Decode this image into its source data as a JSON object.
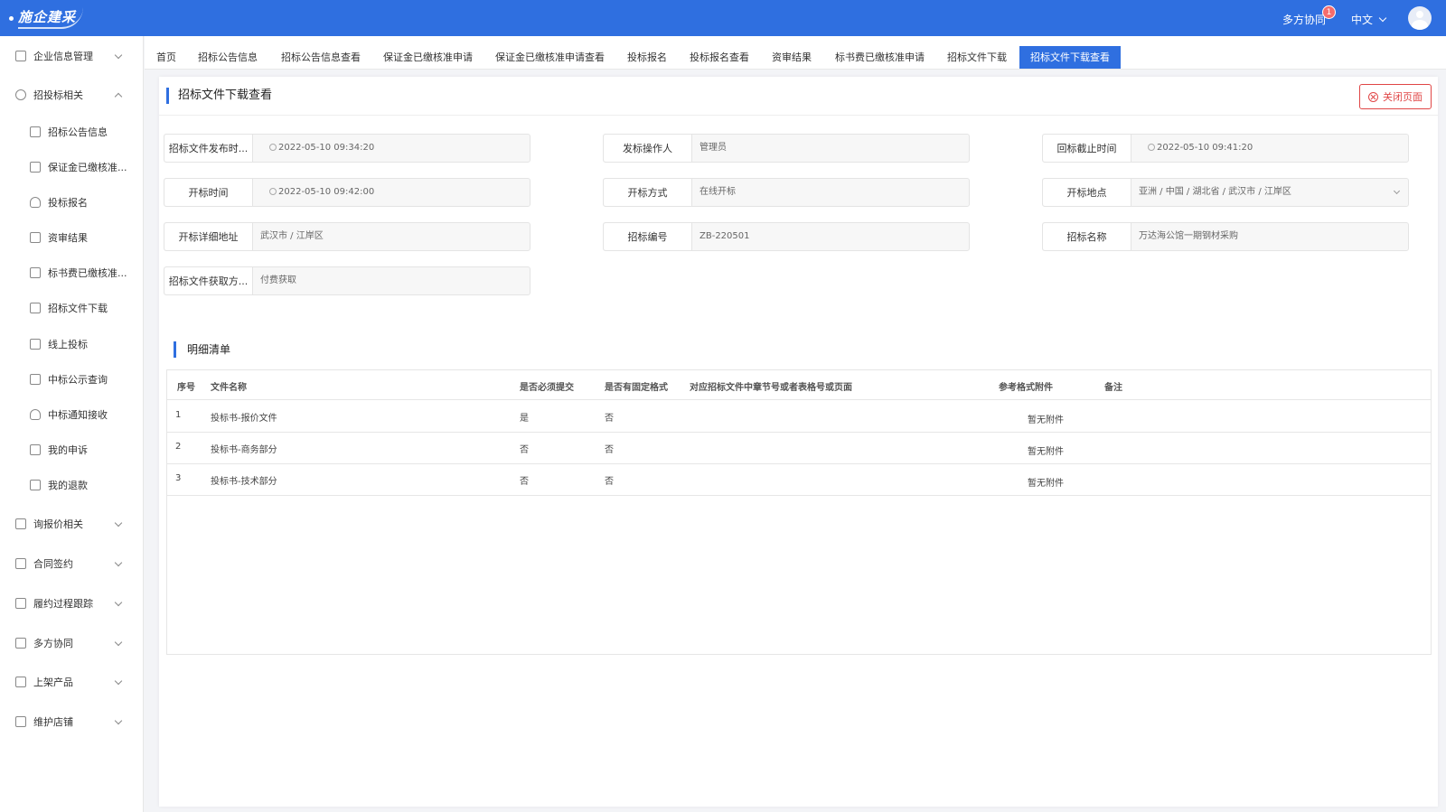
{
  "header": {
    "logo_text": "施企建采",
    "collab_label": "多方协同",
    "collab_badge": "1",
    "language": "中文"
  },
  "sidebar": {
    "items": [
      {
        "label": "企业信息管理",
        "icon": "document-icon",
        "level": "top",
        "expanded": false
      },
      {
        "label": "招投标相关",
        "icon": "target-icon",
        "level": "top",
        "expanded": true
      },
      {
        "label": "招标公告信息",
        "icon": "notice-icon",
        "level": "sub"
      },
      {
        "label": "保证金已缴核准...",
        "icon": "clipboard-icon",
        "level": "sub"
      },
      {
        "label": "投标报名",
        "icon": "user-icon",
        "level": "sub"
      },
      {
        "label": "资审结果",
        "icon": "check-clipboard-icon",
        "level": "sub"
      },
      {
        "label": "标书费已缴核准...",
        "icon": "file-icon",
        "level": "sub"
      },
      {
        "label": "招标文件下载",
        "icon": "org-icon",
        "level": "sub"
      },
      {
        "label": "线上投标",
        "icon": "upload-file-icon",
        "level": "sub"
      },
      {
        "label": "中标公示查询",
        "icon": "list-icon",
        "level": "sub"
      },
      {
        "label": "中标通知接收",
        "icon": "user-notify-icon",
        "level": "sub"
      },
      {
        "label": "我的申诉",
        "icon": "appeal-icon",
        "level": "sub"
      },
      {
        "label": "我的退款",
        "icon": "refund-icon",
        "level": "sub"
      },
      {
        "label": "询报价相关",
        "icon": "quote-icon",
        "level": "top",
        "expanded": false
      },
      {
        "label": "合同签约",
        "icon": "contract-icon",
        "level": "top",
        "expanded": false
      },
      {
        "label": "履约过程跟踪",
        "icon": "tracking-icon",
        "level": "top",
        "expanded": false
      },
      {
        "label": "多方协同",
        "icon": "collab-icon",
        "level": "top",
        "expanded": false
      },
      {
        "label": "上架产品",
        "icon": "product-icon",
        "level": "top",
        "expanded": false
      },
      {
        "label": "维护店铺",
        "icon": "store-icon",
        "level": "top",
        "expanded": false
      }
    ]
  },
  "tabs": [
    {
      "label": "首页",
      "active": false
    },
    {
      "label": "招标公告信息",
      "active": false
    },
    {
      "label": "招标公告信息查看",
      "active": false
    },
    {
      "label": "保证金已缴核准申请",
      "active": false
    },
    {
      "label": "保证金已缴核准申请查看",
      "active": false
    },
    {
      "label": "投标报名",
      "active": false
    },
    {
      "label": "投标报名查看",
      "active": false
    },
    {
      "label": "资审结果",
      "active": false
    },
    {
      "label": "标书费已缴核准申请",
      "active": false
    },
    {
      "label": "招标文件下载",
      "active": false
    },
    {
      "label": "招标文件下载查看",
      "active": true
    }
  ],
  "page": {
    "title": "招标文件下载查看",
    "close_button": "关闭页面"
  },
  "fields": [
    {
      "label": "招标文件发布时...",
      "value": "2022-05-10 09:34:20",
      "type": "datetime"
    },
    {
      "label": "发标操作人",
      "value": "管理员",
      "type": "text"
    },
    {
      "label": "回标截止时间",
      "value": "2022-05-10 09:41:20",
      "type": "datetime"
    },
    {
      "label": "开标时间",
      "value": "2022-05-10 09:42:00",
      "type": "datetime"
    },
    {
      "label": "开标方式",
      "value": "在线开标",
      "type": "text"
    },
    {
      "label": "开标地点",
      "value": "亚洲 / 中国 / 湖北省 / 武汉市 / 江岸区",
      "type": "select"
    },
    {
      "label": "开标详细地址",
      "value": "武汉市 / 江岸区",
      "type": "text"
    },
    {
      "label": "招标编号",
      "value": "ZB-220501",
      "type": "text"
    },
    {
      "label": "招标名称",
      "value": "万达海公馆一期钢材采购",
      "type": "text"
    },
    {
      "label": "招标文件获取方...",
      "value": "付费获取",
      "type": "text"
    }
  ],
  "detail": {
    "title": "明细清单",
    "columns": [
      "序号",
      "文件名称",
      "是否必须提交",
      "是否有固定格式",
      "对应招标文件中章节号或者表格号或页面",
      "参考格式附件",
      "备注"
    ],
    "rows": [
      {
        "index": "1",
        "name": "投标书-报价文件",
        "required": "是",
        "fixed_format": "否",
        "chapter": "",
        "attachment": "暂无附件",
        "remark": ""
      },
      {
        "index": "2",
        "name": "投标书-商务部分",
        "required": "否",
        "fixed_format": "否",
        "chapter": "",
        "attachment": "暂无附件",
        "remark": ""
      },
      {
        "index": "3",
        "name": "投标书-技术部分",
        "required": "否",
        "fixed_format": "否",
        "chapter": "",
        "attachment": "暂无附件",
        "remark": ""
      }
    ]
  },
  "colors": {
    "primary": "#2f6fe0",
    "danger": "#e04545",
    "badge": "#f56c6c"
  }
}
